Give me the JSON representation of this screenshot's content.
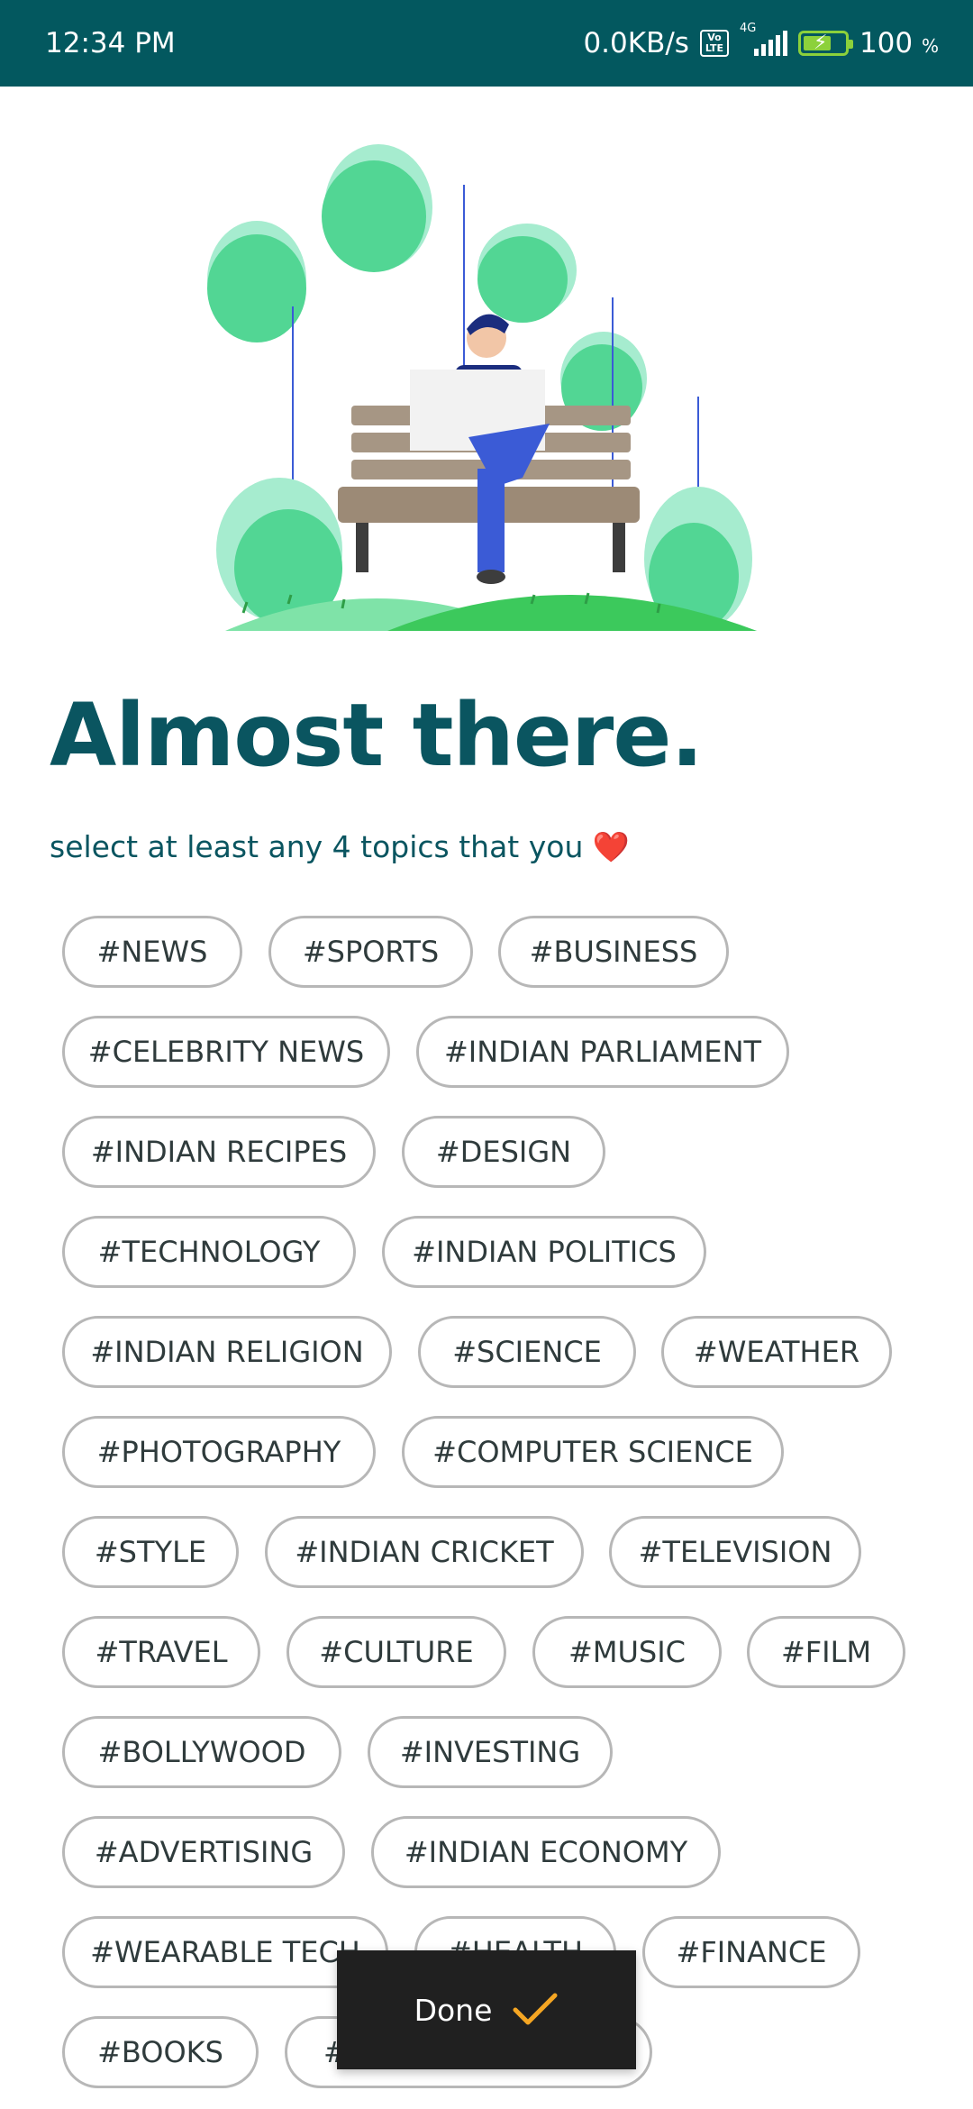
{
  "status": {
    "time": "12:34 PM",
    "speed": "0.0KB/s",
    "volte_top": "Vo",
    "volte_bottom": "LTE",
    "network": "4G",
    "battery": "100",
    "battery_unit": "%"
  },
  "header": {
    "title": "Almost there.",
    "subtitle": "select at least any 4 topics that you",
    "heart": "❤️"
  },
  "topics": [
    "#NEWS",
    "#SPORTS",
    "#BUSINESS",
    "#CELEBRITY NEWS",
    "#INDIAN PARLIAMENT",
    "#INDIAN RECIPES",
    "#DESIGN",
    "#TECHNOLOGY",
    "#INDIAN POLITICS",
    "#INDIAN RELIGION",
    "#SCIENCE",
    "#WEATHER",
    "#PHOTOGRAPHY",
    "#COMPUTER SCIENCE",
    "#STYLE",
    "#INDIAN CRICKET",
    "#TELEVISION",
    "#TRAVEL",
    "#CULTURE",
    "#MUSIC",
    "#FILM",
    "#BOLLYWOOD",
    "#INVESTING",
    "#ADVERTISING",
    "#INDIAN ECONOMY",
    "#WEARABLE TECH",
    "#HEALTH",
    "#FINANCE",
    "#BOOKS",
    "#"
  ],
  "done_label": "Done",
  "colors": {
    "statusbar": "#03585f",
    "heading": "#0a5560",
    "chip_border": "#b7b7b7",
    "done_bg": "#202020",
    "check": "#f5a623"
  }
}
